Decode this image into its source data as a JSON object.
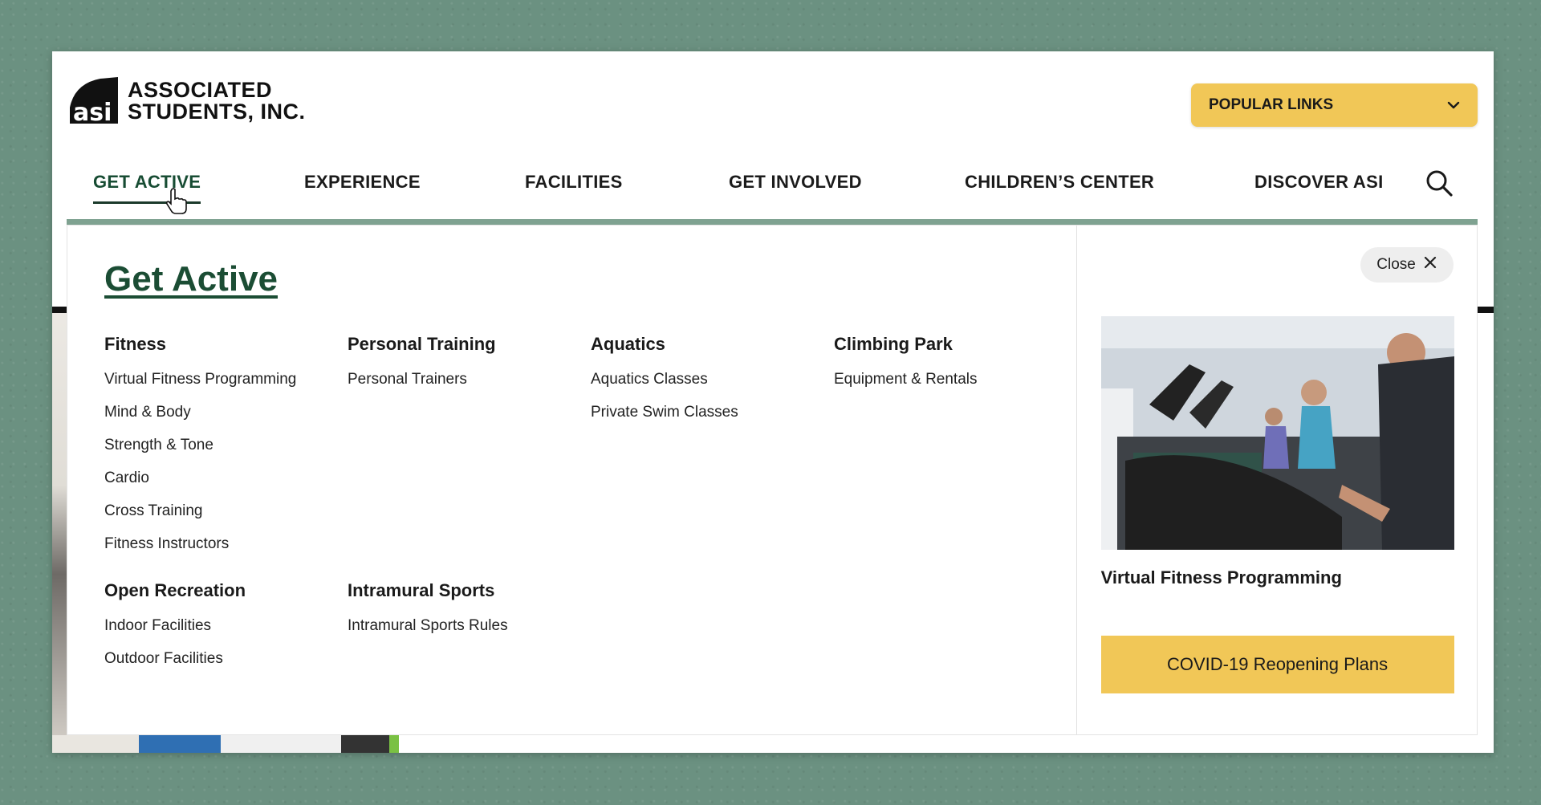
{
  "brand": {
    "logo_mark": "asi",
    "name_line1": "ASSOCIATED",
    "name_line2": "STUDENTS, INC."
  },
  "header": {
    "popular_links_label": "POPULAR LINKS",
    "popular_links_icon": "chevron-down-icon"
  },
  "nav": {
    "items": [
      {
        "label": "GET ACTIVE",
        "active": true
      },
      {
        "label": "EXPERIENCE"
      },
      {
        "label": "FACILITIES"
      },
      {
        "label": "GET INVOLVED"
      },
      {
        "label": "CHILDREN’S CENTER"
      },
      {
        "label": "DISCOVER ASI"
      }
    ],
    "search_icon": "search-icon"
  },
  "mega_menu": {
    "title": "Get Active",
    "columns": [
      {
        "heading": "Fitness",
        "links": [
          "Virtual Fitness Programming",
          "Mind & Body",
          "Strength & Tone",
          "Cardio",
          "Cross Training",
          "Fitness Instructors"
        ]
      },
      {
        "heading": "Personal Training",
        "links": [
          "Personal Trainers"
        ]
      },
      {
        "heading": "Aquatics",
        "links": [
          "Aquatics Classes",
          "Private Swim Classes"
        ]
      },
      {
        "heading": "Climbing Park",
        "links": [
          "Equipment & Rentals"
        ]
      },
      {
        "heading": "Open Recreation",
        "links": [
          "Indoor Facilities",
          "Outdoor Facilities"
        ]
      },
      {
        "heading": "Intramural Sports",
        "links": [
          "Intramural Sports Rules"
        ]
      }
    ],
    "side": {
      "close_label": "Close",
      "close_icon": "close-icon",
      "feature_caption": "Virtual Fitness Programming",
      "cta_label": "COVID-19 Reopening Plans"
    }
  },
  "colors": {
    "background_green": "#6b9181",
    "accent_yellow": "#f1c757",
    "title_green": "#1b4d34",
    "rule_green": "#7fa291"
  }
}
